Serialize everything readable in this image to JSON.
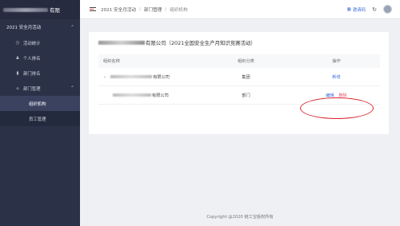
{
  "sidebar": {
    "brand_suffix": "有限",
    "group_label": "2021 安全月活动",
    "items": [
      {
        "label": "活动统计",
        "icon": "clock-icon"
      },
      {
        "label": "个人排名",
        "icon": "person-icon"
      },
      {
        "label": "部门排名",
        "icon": "bar-chart-icon"
      },
      {
        "label": "部门管理",
        "icon": "home-icon"
      }
    ],
    "sub_items": [
      {
        "label": "组织机构",
        "active": true
      },
      {
        "label": "员工管理",
        "active": false
      }
    ]
  },
  "header": {
    "breadcrumbs": [
      "2021 安全月活动",
      "部门管理",
      "组织机构"
    ],
    "invite_label": "邀请码"
  },
  "card": {
    "title_suffix": "有限公司（2021全国安全生产月知识竞赛活动）"
  },
  "table": {
    "headers": [
      "组织名称",
      "组织分类",
      "操作"
    ],
    "rows": [
      {
        "name_suffix": "有限公司",
        "category": "集团",
        "actions": [
          "新增"
        ]
      },
      {
        "name_suffix": "有限公司",
        "category": "部门",
        "actions": [
          "编辑",
          "删除"
        ]
      }
    ]
  },
  "footer": {
    "copyright": "Copyright @2020 链工宝版权所有"
  },
  "colors": {
    "sidebar_bg": "#2b3147",
    "accent": "#3a6fd8",
    "danger_link": "#e55a6b",
    "annotation": "#d9262f"
  }
}
